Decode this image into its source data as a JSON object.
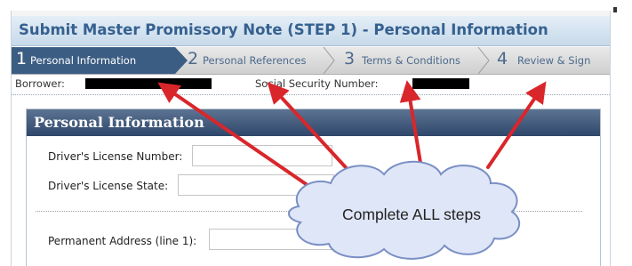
{
  "title": "Submit Master Promissory Note (STEP 1) - Personal Information",
  "steps": [
    {
      "num": "1",
      "label": "Personal Information",
      "active": true
    },
    {
      "num": "2",
      "label": "Personal References",
      "active": false
    },
    {
      "num": "3",
      "label": "Terms & Conditions",
      "active": false
    },
    {
      "num": "4",
      "label": "Review & Sign",
      "active": false
    }
  ],
  "info": {
    "borrower_label": "Borrower:",
    "ssn_label": "Social Security Number:"
  },
  "panel": {
    "title": "Personal Information",
    "fields": {
      "license_number_label": "Driver's License Number:",
      "license_state_label": "Driver's License State:",
      "address1_label": "Permanent Address (line 1):"
    }
  },
  "callout": {
    "text": "Complete ALL steps"
  },
  "colors": {
    "title": "#35618f",
    "active_step": "#3b5d83",
    "arrow": "#d9262b",
    "callout_fill": "#dfe6f7",
    "callout_border": "#7a8fc4"
  }
}
